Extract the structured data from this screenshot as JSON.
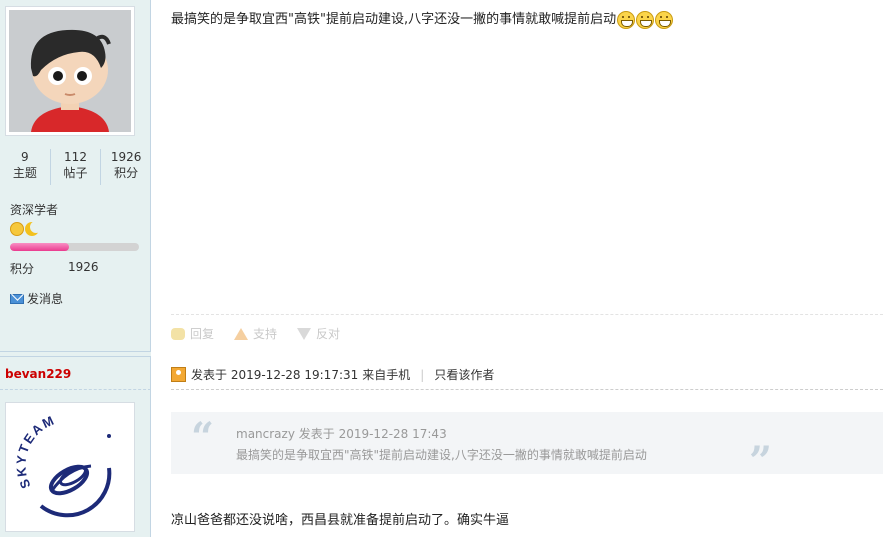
{
  "post1": {
    "author_stats": [
      {
        "value": "9",
        "label": "主题"
      },
      {
        "value": "112",
        "label": "帖子"
      },
      {
        "value": "1926",
        "label": "积分"
      }
    ],
    "rank": "资深学者",
    "score_label": "积分",
    "score_value": "1926",
    "progress_fraction": 0.46,
    "send_message": "发消息",
    "content": "最搞笑的是争取宜西\"高铁\"提前启动建设,八字还没一撇的事情就敢喊提前启动",
    "emoji_icons": [
      "grin-icon",
      "grin-icon",
      "grin-icon"
    ],
    "actions": {
      "reply": "回复",
      "support": "支持",
      "oppose": "反对"
    }
  },
  "post2": {
    "username": "bevan229",
    "posted_on": "发表于 2019-12-28 19:17:31",
    "source": "来自手机",
    "only_author": "只看该作者",
    "quote_author": "mancrazy 发表于 2019-12-28 17:43",
    "quote_text": "最搞笑的是争取宜西\"高铁\"提前启动建设,八字还没一撇的事情就敢喊提前启动",
    "avatar_text": "SKYTEAM",
    "content": "凉山爸爸都还没说啥，西昌县就准备提前启动了。确实牛逼"
  },
  "colors": {
    "sidebar_bg": "#e6f1f1",
    "username": "#cc0000",
    "progress": "#ea3b8f"
  }
}
